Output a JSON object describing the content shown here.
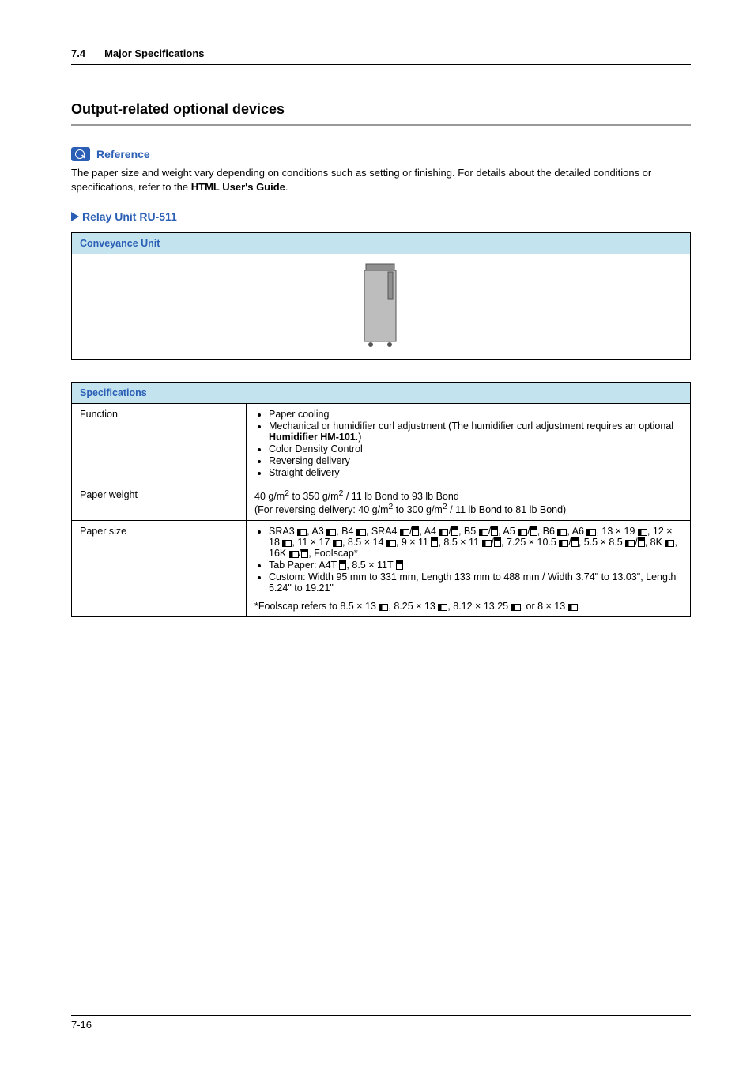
{
  "header": {
    "section_number": "7.4",
    "section_title": "Major Specifications"
  },
  "h2": "Output-related optional devices",
  "reference": {
    "label": "Reference",
    "body_pre": "The paper size and weight vary depending on conditions such as setting or finishing. For details about the detailed conditions or specifications, refer to the ",
    "body_bold": "HTML User's Guide",
    "body_post": "."
  },
  "sub_heading": "Relay Unit RU-511",
  "table1_header": "Conveyance Unit",
  "table2": {
    "header": "Specifications",
    "rows": {
      "function": {
        "label": "Function",
        "items_pre1": "Paper cooling",
        "items_pre2a": "Mechanical or humidifier curl adjustment (The humidifier curl adjustment requires an optional ",
        "items_pre2b": "Humidifier HM-101",
        "items_pre2c": ".)",
        "items_pre3": "Color Density Control",
        "items_pre4": "Reversing delivery",
        "items_pre5": "Straight delivery"
      },
      "paper_weight": {
        "label": "Paper weight",
        "line1a": "40 g/m",
        "line1b": " to 350 g/m",
        "line1c": " / 11 lb Bond to 93 lb Bond",
        "line2a": "(For reversing delivery: 40 g/m",
        "line2b": " to 300 g/m",
        "line2c": " / 11 lb Bond to 81 lb Bond)"
      },
      "paper_size": {
        "label": "Paper size",
        "b1_parts": [
          "SRA3 ",
          ", A3 ",
          ", B4 ",
          ", SRA4 ",
          "/",
          ", A4 ",
          "/",
          ", B5 ",
          "/",
          ", A5 ",
          "/",
          ", B6 ",
          ", A6 ",
          ", 13 × 19 ",
          ", 12 × 18 ",
          ", 11 × 17 ",
          ", 8.5 × 14 ",
          ", 9 × 11 ",
          ", 8.5 × 11 ",
          "/",
          ", 7.25 × 10.5 ",
          "/",
          ", 5.5 × 8.5 ",
          "/",
          ", 8K ",
          ", 16K ",
          "/",
          ", Foolscap*"
        ],
        "b2_parts": [
          "Tab Paper: A4T ",
          ", 8.5 × 11T "
        ],
        "b3": "Custom: Width 95 mm to 331 mm, Length 133 mm to 488 mm / Width 3.74\" to 13.03\", Length 5.24\" to 19.21\"",
        "note_parts": [
          "*Foolscap refers to 8.5 × 13 ",
          ", 8.25 × 13 ",
          ", 8.12 × 13.25 ",
          ", or 8 × 13 ",
          "."
        ]
      }
    }
  },
  "footer": {
    "page": "7-16"
  }
}
